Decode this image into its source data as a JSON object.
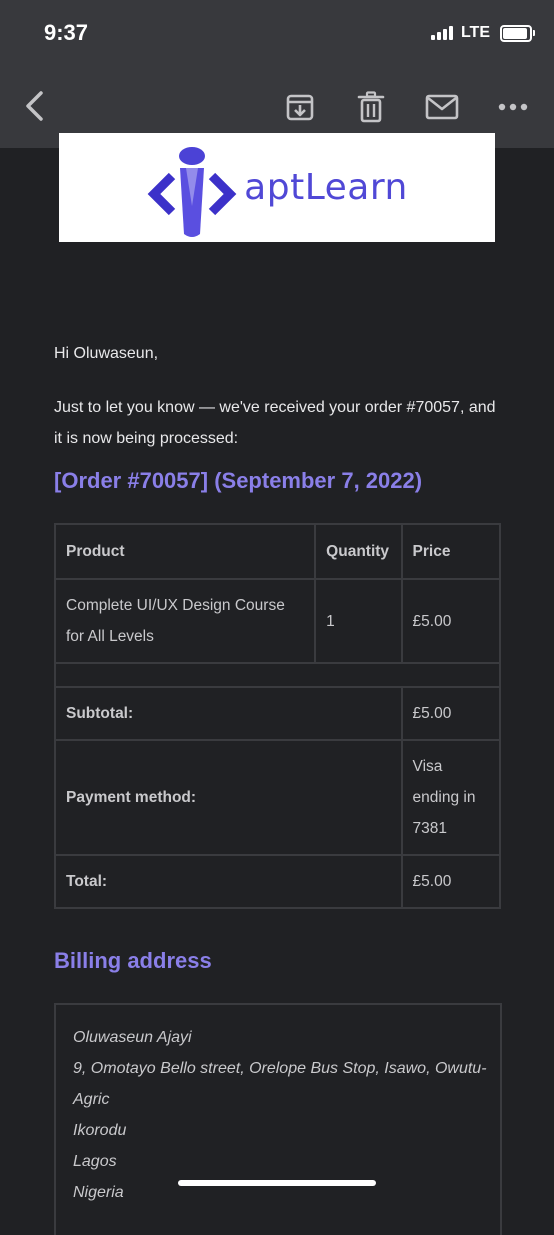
{
  "status_bar": {
    "time": "9:37",
    "network": "LTE"
  },
  "toolbar": {
    "back_icon": "chevron-left-icon",
    "archive_icon": "archive-icon",
    "delete_icon": "trash-icon",
    "mail_icon": "mail-icon",
    "more_icon": "more-horizontal-icon"
  },
  "logo": {
    "text": "aptLearn",
    "color": "#5048d6"
  },
  "email": {
    "greeting": "Hi Oluwaseun,",
    "intro": "Just to let you know — we've received your order #70057, and it is now being processed:",
    "order_heading": "[Order #70057] (September 7, 2022)",
    "accent_color": "#8a7fe8"
  },
  "order_table": {
    "headers": {
      "product": "Product",
      "quantity": "Quantity",
      "price": "Price"
    },
    "items": [
      {
        "product": "Complete UI/UX Design Course for All Levels",
        "quantity": "1",
        "price": "£5.00"
      }
    ],
    "subtotal": {
      "label": "Subtotal:",
      "value": "£5.00"
    },
    "payment": {
      "label": "Payment method:",
      "value": "Visa ending in 7381"
    },
    "total": {
      "label": "Total:",
      "value": "£5.00"
    }
  },
  "billing": {
    "heading": "Billing address",
    "name": "Oluwaseun Ajayi",
    "street": "9, Omotayo Bello street, Orelope Bus Stop, Isawo, Owutu-Agric",
    "city": "Ikorodu",
    "state": "Lagos",
    "country": "Nigeria"
  }
}
